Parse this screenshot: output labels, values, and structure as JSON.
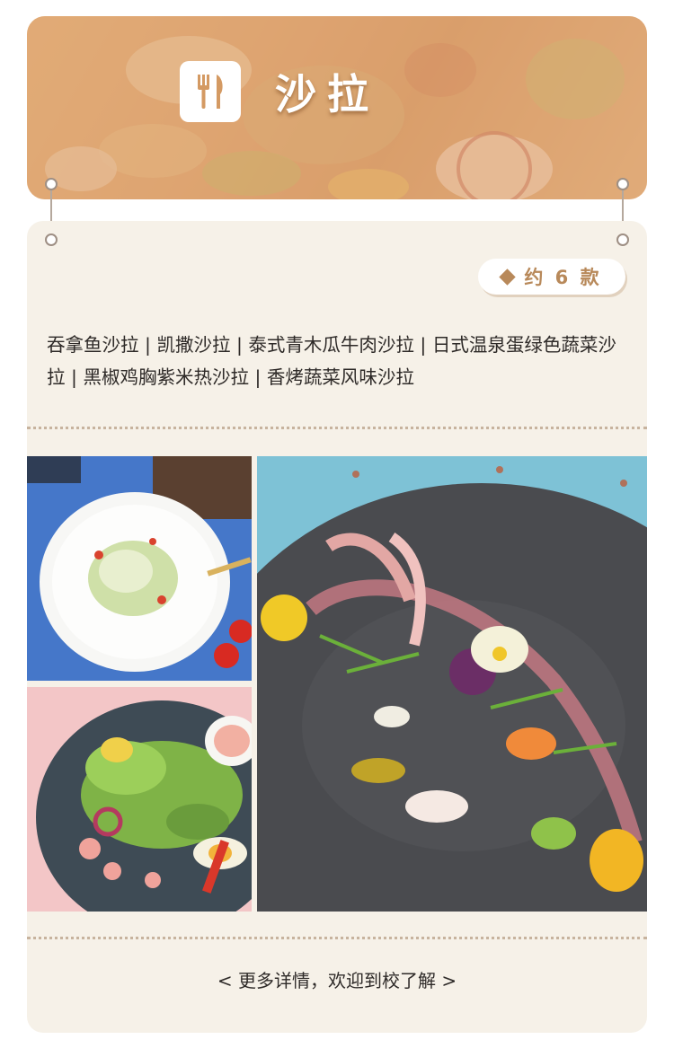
{
  "header": {
    "title": "沙拉",
    "icon": "fork-knife-icon"
  },
  "card": {
    "count_label": "约 6 款",
    "items_text": "吞拿鱼沙拉 | 凯撒沙拉 | 泰式青木瓜牛肉沙拉 | 日式温泉蛋绿色蔬菜沙拉 | 黑椒鸡胸紫米热沙拉 | 香烤蔬菜风味沙拉"
  },
  "photos": [
    {
      "name": "caesar-salad-photo"
    },
    {
      "name": "garden-salad-photo"
    },
    {
      "name": "octopus-salad-photo"
    }
  ],
  "footer": {
    "more_label": "< 更多详情，欢迎到校了解 >"
  },
  "colors": {
    "accent": "#b8895a",
    "card_bg": "#f6f1e8",
    "banner": "#dca26c"
  }
}
